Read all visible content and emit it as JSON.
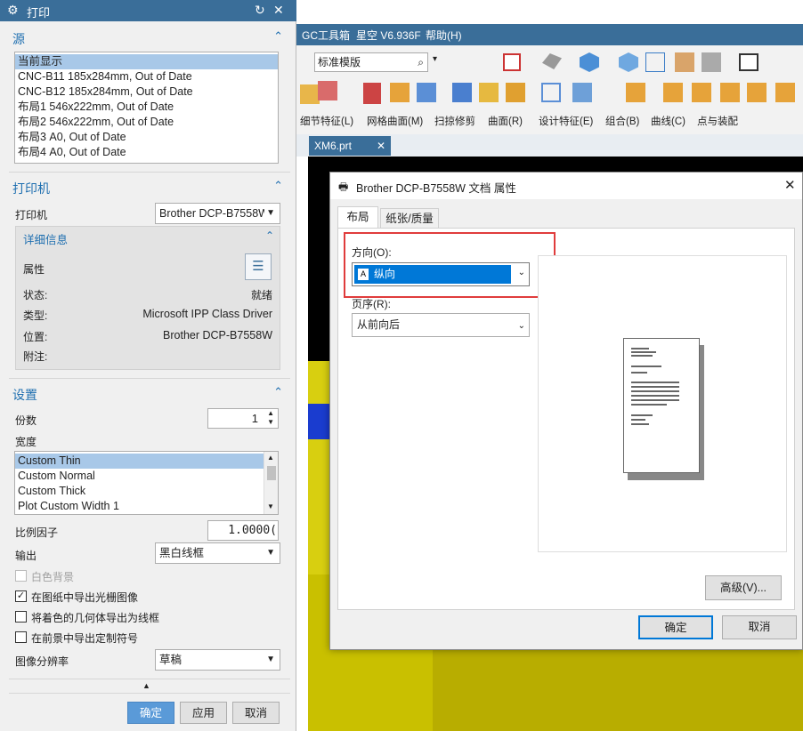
{
  "panel": {
    "title": "打印",
    "source": {
      "header": "源",
      "items": [
        "当前显示",
        "CNC-B11  185x284mm, Out of Date",
        "CNC-B12  185x284mm, Out of Date",
        "布局1  546x222mm, Out of Date",
        "布局2  546x222mm, Out of Date",
        "布局3  A0, Out of Date",
        "布局4  A0, Out of Date"
      ]
    },
    "printer": {
      "header": "打印机",
      "label": "打印机",
      "value": "Brother DCP-B7558W",
      "details_header": "详细信息",
      "properties_label": "属性",
      "status_label": "状态:",
      "status_value": "就绪",
      "type_label": "类型:",
      "type_value": "Microsoft IPP Class Driver",
      "location_label": "位置:",
      "location_value": "Brother DCP-B7558W",
      "comment_label": "附注:"
    },
    "settings": {
      "header": "设置",
      "copies_label": "份数",
      "copies_value": "1",
      "width_label": "宽度",
      "widths": [
        "Custom Thin",
        "Custom Normal",
        "Custom Thick",
        "Plot Custom Width 1"
      ],
      "scale_label": "比例因子",
      "scale_value": "1.0000(",
      "output_label": "输出",
      "output_value": "黑白线框",
      "white_bg": "白色背景",
      "raster": "在图纸中导出光栅图像",
      "shaded_wire": "将着色的几何体导出为线框",
      "custom_symbol": "在前景中导出定制符号",
      "resolution_label": "图像分辨率",
      "resolution_value": "草稿"
    },
    "ok": "确定",
    "apply": "应用",
    "cancel": "取消"
  },
  "nx": {
    "menu": [
      "GC工具箱",
      "星空 V6.936F",
      "帮助(H)"
    ],
    "template": "标准模版",
    "ribbon": [
      "细节特征(L)",
      "网格曲面(M)",
      "扫掠修剪",
      "曲面(R)",
      "设计特征(E)",
      "组合(B)",
      "曲线(C)",
      "点与装配"
    ],
    "file_tab": "XM6.prt"
  },
  "dialog": {
    "title": "Brother DCP-B7558W 文档 属性",
    "tabs": [
      "布局",
      "纸张/质量"
    ],
    "orientation_label": "方向(O):",
    "orientation_value": "纵向",
    "page_order_label": "页序(R):",
    "page_order_value": "从前向后",
    "advanced": "高级(V)...",
    "ok": "确定",
    "cancel": "取消"
  },
  "colors": {
    "title_blue": "#3a6e99",
    "accent": "#1f6fb0",
    "highlight_red": "#e03c3c",
    "select_blue": "#0078d7",
    "model_yellow": "#ddd300"
  }
}
